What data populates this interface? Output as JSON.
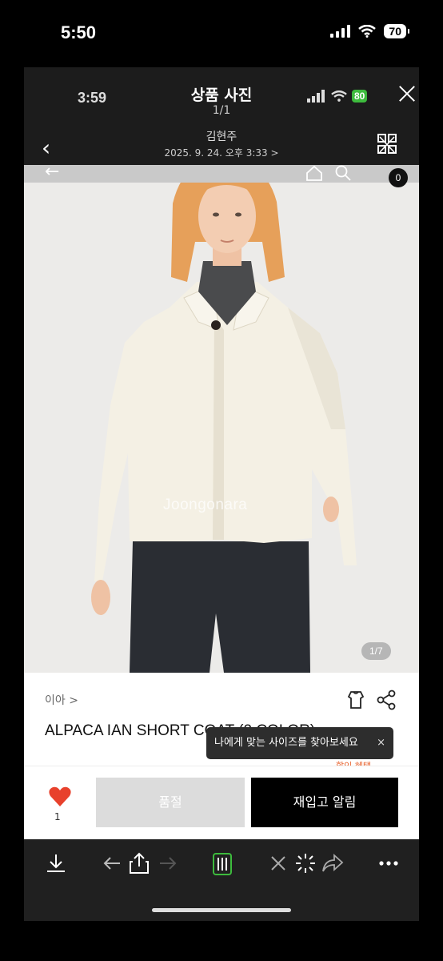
{
  "outer_status": {
    "time": "5:50",
    "battery": "70"
  },
  "viewer": {
    "inner_time": "3:59",
    "title": "상품 사진",
    "count": "1/1",
    "inner_battery": "80",
    "sender": "김현주",
    "sent_date": "2025. 9. 24. 오후 3:33 >"
  },
  "product_page": {
    "cart_count": "0",
    "watermark": "Joongonara",
    "photo_counter": "1/7",
    "brand": "이아 >",
    "product_name": "ALPACA IAN SHORT COAT (2 COLOR)",
    "size_tooltip": "나에게 맞는 사이즈를 찾아보세요",
    "tooltip_close": "×",
    "discount_peek": "할인 혜택",
    "like_count": "1",
    "soldout_label": "품절",
    "restock_label": "재입고 알림"
  },
  "colors": {
    "accent_green": "#3dbb3d",
    "heart_red": "#e8412c",
    "restock_bg": "#000000",
    "soldout_bg": "#dcdcdc"
  }
}
